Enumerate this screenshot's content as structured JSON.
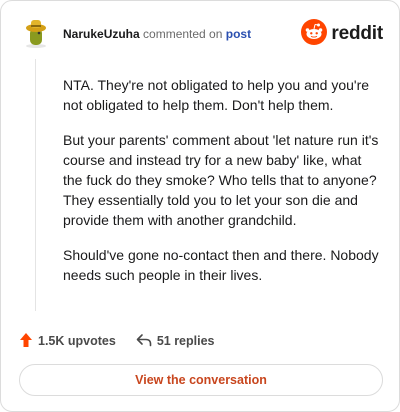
{
  "header": {
    "username": "NarukeUzuha",
    "action_text": "commented on",
    "post_link": "post",
    "brand_name": "reddit"
  },
  "comment": {
    "paragraphs": [
      "NTA. They're not obligated to help you and you're not obligated to help them. Don't help them.",
      "But your parents' comment about 'let nature run it's course and instead try for a new baby' like, what the fuck do they smoke? Who tells that to anyone? They essentially told you to let your son die and provide them with another grandchild.",
      "Should've gone no-contact then and there. Nobody needs such people in their lives."
    ]
  },
  "stats": {
    "upvotes": "1.5K upvotes",
    "replies": "51 replies"
  },
  "cta": {
    "label": "View the conversation"
  },
  "colors": {
    "brand_orange": "#ff4500",
    "cta_text": "#c8461e",
    "link_blue": "#2a4fb0"
  },
  "icons": {
    "avatar": "avatar-icon",
    "brand": "reddit-logo-icon",
    "upvote": "upvote-arrow-icon",
    "reply": "reply-arrow-icon"
  }
}
